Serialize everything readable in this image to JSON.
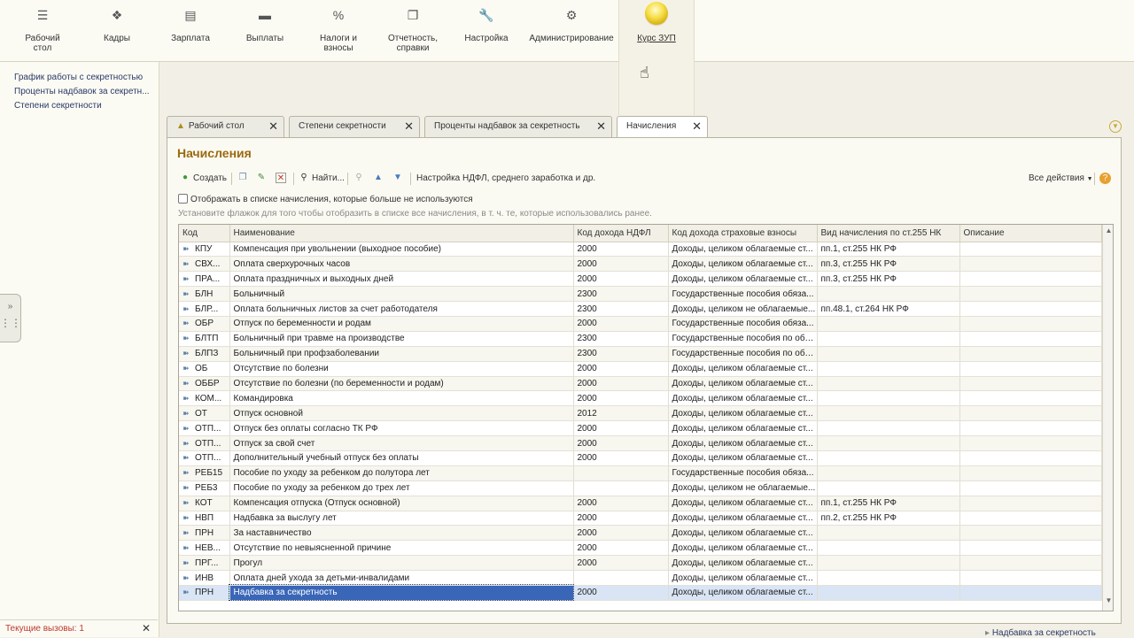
{
  "sections": [
    {
      "label": "Рабочий\nстол",
      "icon": "menu-icon"
    },
    {
      "label": "Кадры",
      "icon": "people-icon"
    },
    {
      "label": "Зарплата",
      "icon": "payroll-icon"
    },
    {
      "label": "Выплаты",
      "icon": "wallet-icon"
    },
    {
      "label": "Налоги и\nвзносы",
      "icon": "percent-icon"
    },
    {
      "label": "Отчетность,\nсправки",
      "icon": "reports-icon"
    },
    {
      "label": "Настройка",
      "icon": "wrench-icon"
    },
    {
      "label": "Администрирование",
      "icon": "gear-icon"
    },
    {
      "label": "Курс ЗУП",
      "icon": "orb-icon"
    }
  ],
  "left_nav": [
    "График работы с секретностью",
    "Проценты надбавок за секретн...",
    "Степени секретности"
  ],
  "calls": {
    "text": "Текущие вызовы: 1",
    "close": "✕"
  },
  "tabs": [
    {
      "label": "Рабочий стол"
    },
    {
      "label": "Степени секретности"
    },
    {
      "label": "Проценты надбавок за секретность"
    },
    {
      "label": "Начисления"
    }
  ],
  "form": {
    "title": "Начисления",
    "toolbar": {
      "create": "Создать",
      "find": "Найти...",
      "settings": "Настройка НДФЛ, среднего заработка и др.",
      "all_actions": "Все действия"
    },
    "checkbox_label": "Отображать в списке начисления, которые больше не используются",
    "hint": "Установите флажок для того чтобы отобразить в списке все начисления, в т. ч. те, которые использовались ранее."
  },
  "table": {
    "columns": [
      "Код",
      "Наименование",
      "Код дохода НДФЛ",
      "Код дохода страховые взносы",
      "Вид начисления по ст.255 НК",
      "Описание"
    ],
    "rows": [
      [
        "КПУ",
        "Компенсация при увольнении (выходное пособие)",
        "2000",
        "Доходы, целиком облагаемые ст...",
        "пп.1, ст.255 НК РФ",
        ""
      ],
      [
        "СВХ...",
        "Оплата сверхурочных часов",
        "2000",
        "Доходы, целиком облагаемые ст...",
        "пп.3, ст.255 НК РФ",
        ""
      ],
      [
        "ПРА...",
        "Оплата праздничных и выходных дней",
        "2000",
        "Доходы, целиком облагаемые ст...",
        "пп.3, ст.255 НК РФ",
        ""
      ],
      [
        "БЛН",
        "Больничный",
        "2300",
        "Государственные пособия обяза...",
        "",
        ""
      ],
      [
        "БЛР...",
        "Оплата больничных листов за счет работодателя",
        "2300",
        "Доходы, целиком не облагаемые...",
        "пп.48.1, ст.264 НК РФ",
        ""
      ],
      [
        "ОБР",
        "Отпуск по беременности и родам",
        "2000",
        "Государственные пособия обяза...",
        "",
        ""
      ],
      [
        "БЛТП",
        "Больничный при травме на производстве",
        "2300",
        "Государственные пособия по обя...",
        "",
        ""
      ],
      [
        "БЛПЗ",
        "Больничный при профзаболевании",
        "2300",
        "Государственные пособия по обя...",
        "",
        ""
      ],
      [
        "ОБ",
        "Отсутствие по болезни",
        "2000",
        "Доходы, целиком облагаемые ст...",
        "",
        ""
      ],
      [
        "ОББР",
        "Отсутствие по болезни (по беременности и родам)",
        "2000",
        "Доходы, целиком облагаемые ст...",
        "",
        ""
      ],
      [
        "КОМ...",
        "Командировка",
        "2000",
        "Доходы, целиком облагаемые ст...",
        "",
        ""
      ],
      [
        "ОТ",
        "Отпуск основной",
        "2012",
        "Доходы, целиком облагаемые ст...",
        "",
        ""
      ],
      [
        "ОТП...",
        "Отпуск без оплаты согласно ТК РФ",
        "2000",
        "Доходы, целиком облагаемые ст...",
        "",
        ""
      ],
      [
        "ОТП...",
        "Отпуск за свой счет",
        "2000",
        "Доходы, целиком облагаемые ст...",
        "",
        ""
      ],
      [
        "ОТП...",
        "Дополнительный учебный отпуск без оплаты",
        "2000",
        "Доходы, целиком облагаемые ст...",
        "",
        ""
      ],
      [
        "РЕБ15",
        "Пособие по уходу за ребенком до полутора лет",
        "",
        "Государственные пособия обяза...",
        "",
        ""
      ],
      [
        "РЕБ3",
        "Пособие по уходу за ребенком до трех лет",
        "",
        "Доходы, целиком не облагаемые...",
        "",
        ""
      ],
      [
        "КОТ",
        "Компенсация отпуска (Отпуск основной)",
        "2000",
        "Доходы, целиком облагаемые ст...",
        "пп.1, ст.255 НК РФ",
        ""
      ],
      [
        "НВП",
        "Надбавка за выслугу лет",
        "2000",
        "Доходы, целиком облагаемые ст...",
        "пп.2, ст.255 НК РФ",
        ""
      ],
      [
        "ПРН",
        "За наставничество",
        "2000",
        "Доходы, целиком облагаемые ст...",
        "",
        ""
      ],
      [
        "НЕВ...",
        "Отсутствие по невыясненной причине",
        "2000",
        "Доходы, целиком облагаемые ст...",
        "",
        ""
      ],
      [
        "ПРГ...",
        "Прогул",
        "2000",
        "Доходы, целиком облагаемые ст...",
        "",
        ""
      ],
      [
        "ИНВ",
        "Оплата дней ухода за детьми-инвалидами",
        "",
        "Доходы, целиком облагаемые ст...",
        "",
        ""
      ],
      [
        "ПРН",
        "Надбавка за секретность",
        "2000",
        "Доходы, целиком облагаемые ст...",
        "",
        ""
      ]
    ],
    "selected_row": 23
  },
  "status_link": "Надбавка за секретность",
  "colors": {
    "title": "#9b6a10",
    "selection": "#3a66b8",
    "link": "#2b3a66"
  }
}
